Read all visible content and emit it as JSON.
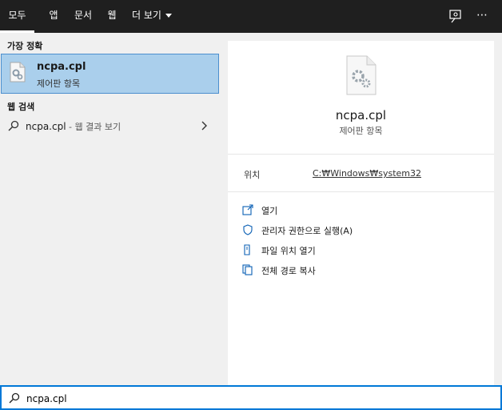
{
  "tabs": [
    {
      "label": "모두",
      "active": true
    },
    {
      "label": "앱"
    },
    {
      "label": "문서"
    },
    {
      "label": "웹"
    },
    {
      "label": "더 보기"
    }
  ],
  "top_icons": {
    "feedback": "feedback-icon",
    "more": "⋯"
  },
  "left": {
    "best_match_title": "가장 정확",
    "best_match": {
      "title": "ncpa.cpl",
      "subtitle": "제어판 항목",
      "icon": "control-panel-file-icon"
    },
    "web_search_title": "웹 검색",
    "web_result": {
      "query": "ncpa.cpl",
      "suffix": " - 웹 결과 보기",
      "icon": "search-icon",
      "chevron": "chevron-right-icon"
    }
  },
  "right": {
    "title": "ncpa.cpl",
    "subtitle": "제어판 항목",
    "location_label": "위치",
    "location_value": "C:₩Windows₩system32",
    "actions": [
      {
        "label": "열기",
        "icon": "open-icon"
      },
      {
        "label": "관리자 권한으로 실행(A)",
        "icon": "shield-icon"
      },
      {
        "label": "파일 위치 열기",
        "icon": "file-location-icon"
      },
      {
        "label": "전체 경로 복사",
        "icon": "copy-icon"
      }
    ]
  },
  "search": {
    "value": "ncpa.cpl",
    "icon": "search-icon"
  },
  "colors": {
    "accent": "#0078d7",
    "selected_bg": "#aacfec",
    "topbar_bg": "#1f1f1f"
  }
}
